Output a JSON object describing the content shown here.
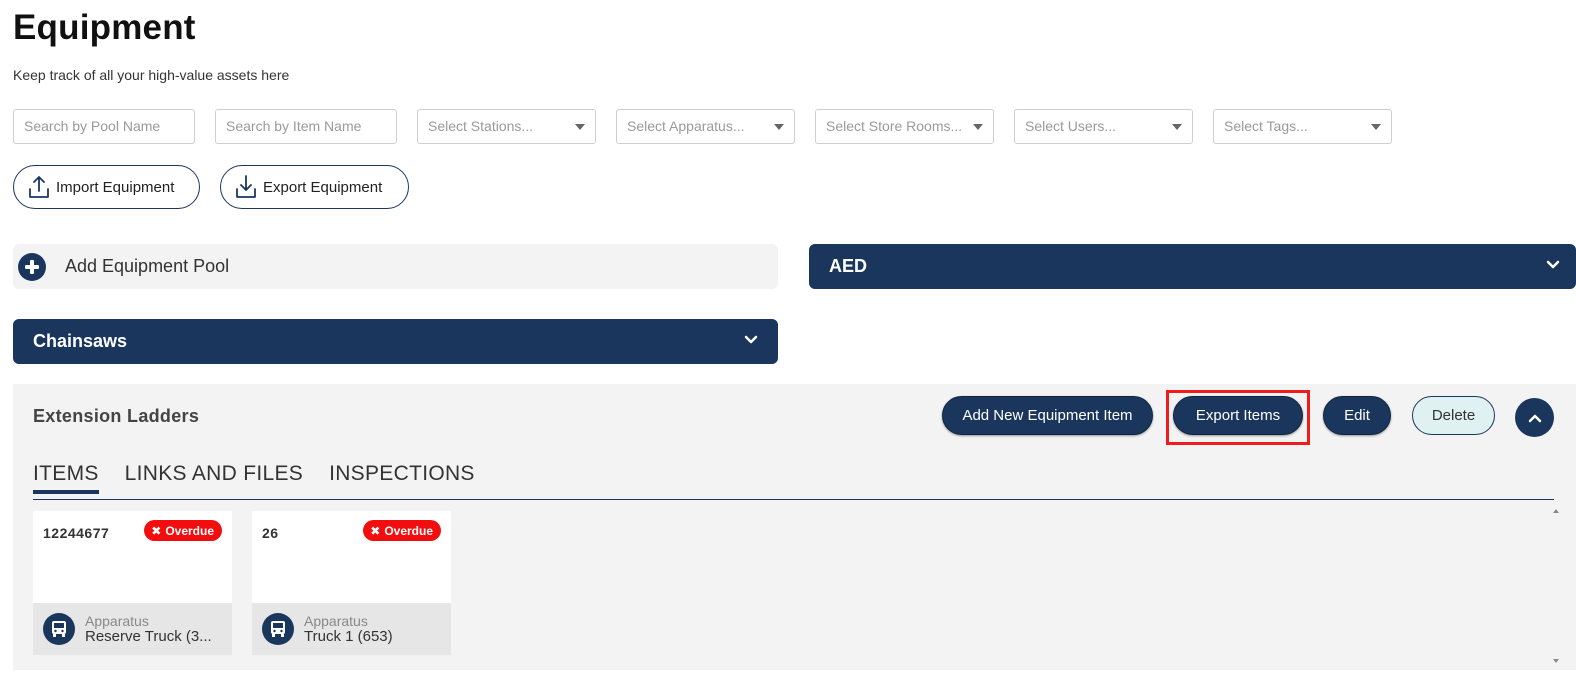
{
  "header": {
    "title": "Equipment",
    "subtitle": "Keep track of all your high-value assets here"
  },
  "filters": {
    "pool_search_placeholder": "Search by Pool Name",
    "item_search_placeholder": "Search by Item Name",
    "stations": "Select Stations...",
    "apparatus": "Select Apparatus...",
    "store_rooms": "Select Store Rooms...",
    "users": "Select Users...",
    "tags": "Select Tags..."
  },
  "actions": {
    "import_label": "Import Equipment",
    "export_label": "Export Equipment"
  },
  "pools": {
    "add_label": "Add Equipment Pool",
    "aed": "AED",
    "chainsaws": "Chainsaws"
  },
  "panel": {
    "title": "Extension Ladders",
    "add_item": "Add New Equipment Item",
    "export_items": "Export Items",
    "edit": "Edit",
    "delete": "Delete",
    "tabs": [
      "ITEMS",
      "LINKS AND FILES",
      "INSPECTIONS"
    ],
    "active_tab": "ITEMS"
  },
  "items": [
    {
      "id": "12244677",
      "status": "Overdue",
      "location_type": "Apparatus",
      "location": "Reserve Truck (3..."
    },
    {
      "id": "26",
      "status": "Overdue",
      "location_type": "Apparatus",
      "location": "Truck 1 (653)"
    }
  ],
  "icons": {
    "upload": "upload-icon",
    "download": "download-icon",
    "plus": "plus-circle-icon",
    "chevron_down": "chevron-down-icon",
    "chevron_up": "chevron-up-icon",
    "truck": "truck-icon",
    "overdue": "x-icon"
  },
  "colors": {
    "primary": "#1b365d",
    "overdue": "#f20e0e",
    "highlight": "#ee1c1c",
    "delete_bg": "#dff1f0",
    "panel_bg": "#f3f3f3"
  }
}
